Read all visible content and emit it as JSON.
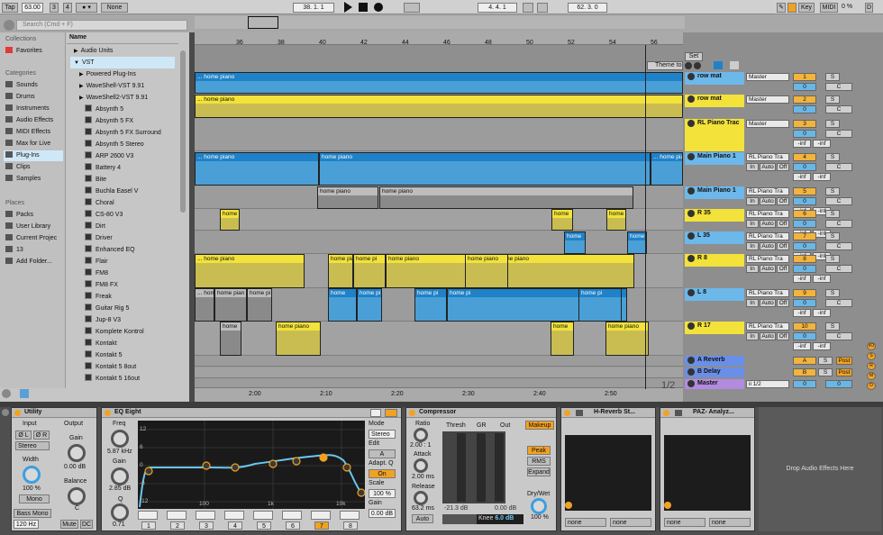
{
  "transport": {
    "tap": "Tap",
    "tempo": "63.00",
    "sig_num": "3",
    "sig_den": "4",
    "metro": "● ▾",
    "quant": "None",
    "position": "38.   1.   1",
    "loop_start": "4.   4.   1",
    "loop_len": "62.   3.   0",
    "key": "Key",
    "midi": "MIDI",
    "cpu": "0 %",
    "d_label": "D"
  },
  "timeline": {
    "ticks": [
      "36",
      "38",
      "40",
      "42",
      "44",
      "46",
      "48",
      "50",
      "52",
      "54",
      "56"
    ],
    "set": "Set",
    "theme_marker": "Theme to",
    "times": [
      "2:00",
      "2:10",
      "2:20",
      "2:30",
      "2:40",
      "2:50"
    ],
    "zoom": "1/2"
  },
  "browser": {
    "search_placeholder": "Search (Cmd + F)",
    "collections_title": "Collections",
    "favorites": "Favorites",
    "categories_title": "Categories",
    "categories": [
      "Sounds",
      "Drums",
      "Instruments",
      "Audio Effects",
      "MIDI Effects",
      "Max for Live",
      "Plug-Ins",
      "Clips",
      "Samples"
    ],
    "places_title": "Places",
    "places": [
      "Packs",
      "User Library",
      "Current Projec",
      "13",
      "Add Folder..."
    ],
    "name_header": "Name",
    "tree": [
      "Audio Units",
      "VST",
      "Powered Plug-Ins",
      "WaveShell-VST 9.91",
      "WaveShell2-VST 9.91"
    ],
    "plugins": [
      "Absynth 5",
      "Absynth 5 FX",
      "Absynth 5 FX Surround",
      "Absynth 5 Stereo",
      "ARP 2600 V3",
      "Battery 4",
      "Bite",
      "Buchla Easel V",
      "Choral",
      "CS-80 V3",
      "Dirt",
      "Driver",
      "Enhanced EQ",
      "Flair",
      "FM8",
      "FM8 FX",
      "Freak",
      "Guitar Rig 5",
      "Jup-8 V3",
      "Komplete Kontrol",
      "Kontakt",
      "Kontakt 5",
      "Kontakt 5 8out",
      "Kontakt 5 16out"
    ]
  },
  "clips": {
    "c1": "... home piano",
    "c2": "... home piano",
    "c3": "... home piano",
    "c4": "home piano",
    "c5": "... home piano",
    "c6": "home piano",
    "c7": "home piano",
    "c8": "d",
    "c9": "Clip Deactivated",
    "c10": "Clip Deactivated",
    "c11": "home",
    "c12": "home",
    "c13": "home",
    "c14": "home",
    "c15": "home",
    "c16": "... home piano",
    "c17": "home piano",
    "c18": "home pi",
    "c19": "home piano",
    "c20": "home piano",
    "c21": "... home",
    "c22": "home pian",
    "c23": "home pi",
    "c24": "Deactivated",
    "c25": "Deactivated",
    "c26": "ectivo",
    "c27": "home",
    "c28": "home piano",
    "c29": "home pi",
    "c30": "home pi",
    "c31": "home pi",
    "c32": "home",
    "c33": "home",
    "c34": "home piano",
    "c35": "home pi",
    "c36": "home piano"
  },
  "tracks": [
    {
      "name": "row mat",
      "io": "Master",
      "num": "1",
      "vol": "0",
      "s": "S",
      "c": "C"
    },
    {
      "name": "row mat",
      "io": "Master",
      "num": "2",
      "vol": "0",
      "s": "S",
      "c": "C"
    },
    {
      "name": "RL Piano Trac",
      "io": "Master",
      "num": "3",
      "vol": "0",
      "s": "S",
      "c": "C",
      "inf1": "-inf",
      "inf2": "-inf"
    },
    {
      "name": "Main Piano 1",
      "io": "RL Piano Tra",
      "num": "4",
      "vol": "0",
      "s": "S",
      "c": "C",
      "inf1": "-inf",
      "inf2": "-inf"
    },
    {
      "name": "Main Piano 1",
      "io": "RL Piano Tra",
      "num": "5",
      "vol": "0",
      "s": "S",
      "c": "C",
      "inf1": "-inf",
      "inf2": "-inf"
    },
    {
      "name": "R 35",
      "io": "RL Piano Tra",
      "num": "6",
      "vol": "0",
      "s": "S",
      "c": "C",
      "inf1": "-inf",
      "inf2": "-inf"
    },
    {
      "name": "L 35",
      "io": "RL Piano Tra",
      "num": "7",
      "vol": "0",
      "s": "S",
      "c": "C",
      "inf1": "-inf",
      "inf2": "-inf"
    },
    {
      "name": "R 8",
      "io": "RL Piano Tra",
      "num": "8",
      "vol": "0",
      "s": "S",
      "c": "C",
      "inf1": "-inf",
      "inf2": "-inf"
    },
    {
      "name": "L 8",
      "io": "RL Piano Tra",
      "num": "9",
      "vol": "0",
      "s": "S",
      "c": "C",
      "inf1": "-inf",
      "inf2": "-inf"
    },
    {
      "name": "R 17",
      "io": "RL Piano Tra",
      "num": "10",
      "vol": "0",
      "s": "S",
      "c": "C",
      "inf1": "-inf",
      "inf2": "-inf"
    }
  ],
  "monitor": {
    "in": "In",
    "auto": "Auto",
    "off": "Off"
  },
  "returns": [
    {
      "name": "A Reverb",
      "letter": "A",
      "vol": "0",
      "s": "S",
      "post": "Post"
    },
    {
      "name": "B Delay",
      "letter": "B",
      "vol": "0",
      "s": "S",
      "post": "Post"
    },
    {
      "name": "Master",
      "io": "ii 1/2",
      "vol": "0",
      "s": "0"
    }
  ],
  "side_buttons": [
    "I/O",
    "S",
    "R",
    "M",
    "D"
  ],
  "utility": {
    "title": "Utility",
    "input": "Input",
    "output": "Output",
    "l": "Ø L",
    "r": "Ø R",
    "mode": "Stereo",
    "gain": "Gain",
    "gain_val": "0.00 dB",
    "width": "Width",
    "width_val": "100 %",
    "balance": "Balance",
    "balance_val": "C",
    "mono": "Mono",
    "bass_mono": "Bass Mono",
    "freq": "120 Hz",
    "mute": "Mute",
    "dc": "DC"
  },
  "eq": {
    "title": "EQ Eight",
    "freq": "Freq",
    "freq_val": "5.87 kHz",
    "gain": "Gain",
    "gain_val": "2.85 dB",
    "q": "Q",
    "q_val": "0.71",
    "db_ticks": [
      "12",
      "6",
      "0",
      "-6",
      "-12"
    ],
    "freq_ticks": [
      "100",
      "1k",
      "10k"
    ],
    "mode": "Mode",
    "mode_val": "Stereo",
    "edit": "Edit",
    "edit_val": "A",
    "adapt": "Adapt. Q",
    "adapt_val": "On",
    "scale": "Scale",
    "scale_val": "100 %",
    "out_gain": "Gain",
    "out_gain_val": "0.00 dB",
    "bands": [
      "1",
      "2",
      "3",
      "4",
      "5",
      "6",
      "7",
      "8"
    ],
    "selected_band": "7",
    "curve_color": "#6ac6f0"
  },
  "comp": {
    "title": "Compressor",
    "ratio": "Ratio",
    "ratio_val": "2.00 : 1",
    "attack": "Attack",
    "attack_val": "2.00 ms",
    "release": "Release",
    "release_val": "63.2 ms",
    "auto": "Auto",
    "thresh": "Thresh",
    "gr": "GR",
    "out": "Out",
    "thresh_val": "-21.3 dB",
    "out_val": "0.00 dB",
    "knee": "Knee",
    "knee_val": "6.0 dB",
    "makeup": "Makeup",
    "peak": "Peak",
    "rms": "RMS",
    "expand": "Expand",
    "drywet": "Dry/Wet",
    "drywet_val": "100 %"
  },
  "reverb": {
    "title": "H-Reverb St...",
    "sel1": "none",
    "sel2": "none"
  },
  "paz": {
    "title": "PAZ- Analyz...",
    "sel1": "none",
    "sel2": "none"
  },
  "drop": "Drop Audio Effects Here",
  "colors": {
    "blue": "#1f82c8",
    "yellow": "#f2e23a",
    "accent": "#f2a221",
    "selected": "#cfe8f7"
  }
}
